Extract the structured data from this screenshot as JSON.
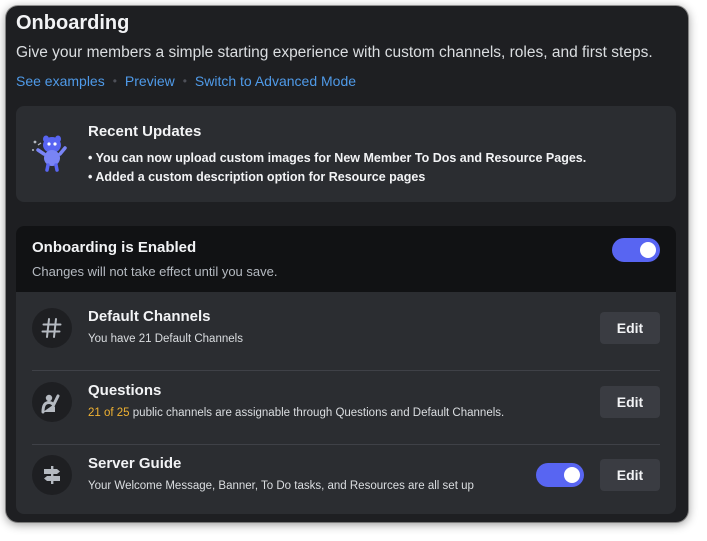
{
  "page": {
    "title": "Onboarding",
    "subtitle": "Give your members a simple starting experience with custom channels, roles, and first steps.",
    "links": {
      "examples": "See examples",
      "preview": "Preview",
      "advanced": "Switch to Advanced Mode",
      "separator": "•"
    }
  },
  "updates": {
    "title": "Recent Updates",
    "items": [
      "• You can now upload custom images for New Member To Dos and Resource Pages.",
      "• Added a custom description option for Resource pages"
    ]
  },
  "onboarding": {
    "title": "Onboarding is Enabled",
    "note": "Changes will not take effect until you save.",
    "enabled": true
  },
  "sections": {
    "default_channels": {
      "title": "Default Channels",
      "desc": "You have 21 Default Channels",
      "edit_label": "Edit"
    },
    "questions": {
      "title": "Questions",
      "desc_highlight": "21 of 25",
      "desc_rest": " public channels are assignable through Questions and Default Channels.",
      "edit_label": "Edit"
    },
    "server_guide": {
      "title": "Server Guide",
      "desc": "Your Welcome Message, Banner, To Do tasks, and Resources are all set up",
      "edit_label": "Edit",
      "enabled": true
    }
  },
  "colors": {
    "background": "#1e1f22",
    "card": "#2b2d31",
    "header_band": "#111214",
    "accent": "#5865f2",
    "link": "#4f9ae8",
    "highlight": "#f0b232"
  },
  "icons": {
    "updates_art": "wumpus-mascot-icon",
    "default_channels": "hash-icon",
    "questions": "raised-hand-icon",
    "server_guide": "signpost-icon"
  }
}
